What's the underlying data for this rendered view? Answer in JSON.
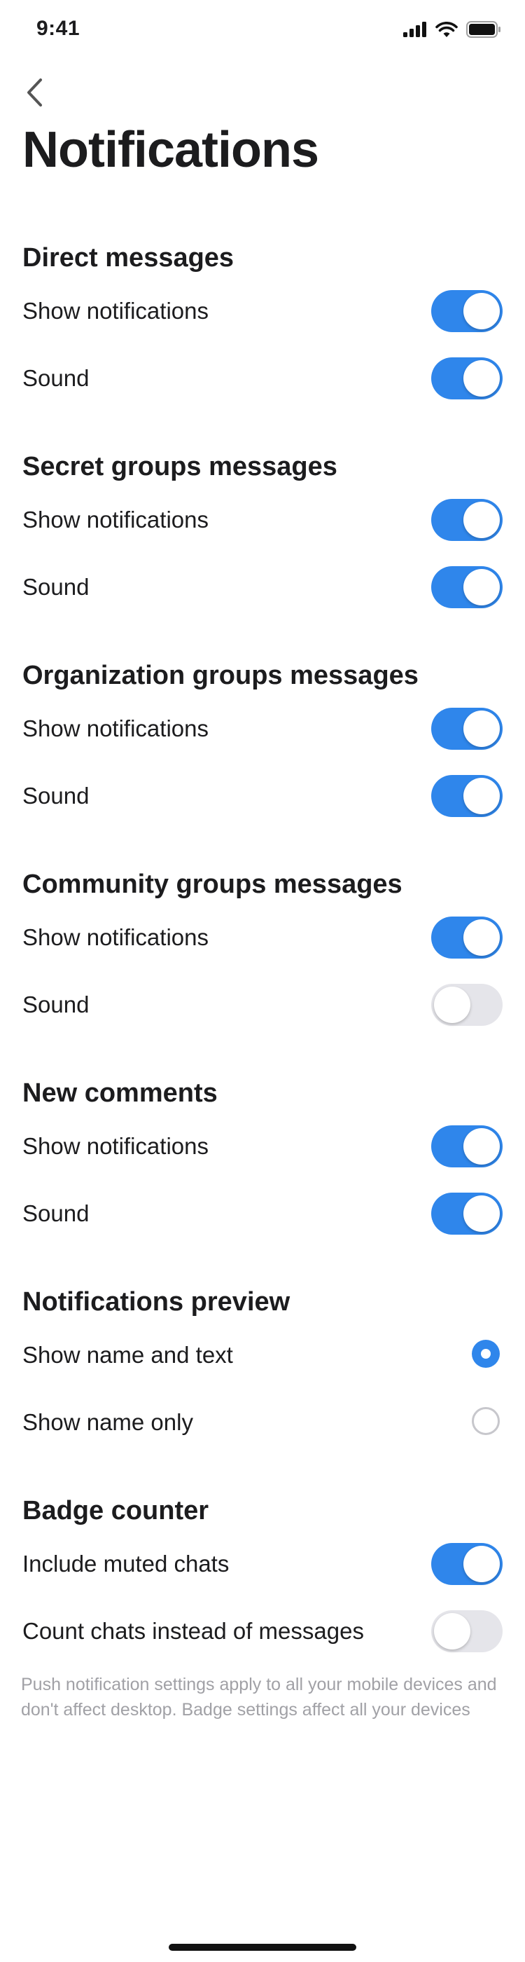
{
  "status_bar": {
    "time": "9:41"
  },
  "page": {
    "title": "Notifications"
  },
  "sections": [
    {
      "title": "Direct messages",
      "rows": [
        {
          "label": "Show notifications",
          "on": true
        },
        {
          "label": "Sound",
          "on": true
        }
      ]
    },
    {
      "title": "Secret groups messages",
      "rows": [
        {
          "label": "Show notifications",
          "on": true
        },
        {
          "label": "Sound",
          "on": true
        }
      ]
    },
    {
      "title": "Organization groups messages",
      "rows": [
        {
          "label": "Show notifications",
          "on": true
        },
        {
          "label": "Sound",
          "on": true
        }
      ]
    },
    {
      "title": "Community groups messages",
      "rows": [
        {
          "label": "Show notifications",
          "on": true
        },
        {
          "label": "Sound",
          "on": false
        }
      ]
    },
    {
      "title": "New comments",
      "rows": [
        {
          "label": "Show notifications",
          "on": true
        },
        {
          "label": "Sound",
          "on": true
        }
      ]
    },
    {
      "title": "Notifications preview",
      "rows": [
        {
          "label": "Show name and text",
          "selected": true
        },
        {
          "label": "Show name only",
          "selected": false
        }
      ]
    },
    {
      "title": "Badge counter",
      "rows": [
        {
          "label": "Include muted chats",
          "on": true
        },
        {
          "label": "Count chats instead of messages",
          "on": false
        }
      ]
    }
  ],
  "footer_note": "Push notification settings apply to all your mobile devices and don't affect desktop. Badge settings affect all your devices",
  "colors": {
    "accent": "#2f86eb",
    "toggle_off": "#e5e5ea",
    "footer_text": "#a1a1a6"
  },
  "icons": [
    "cellular-signal-icon",
    "wifi-icon",
    "battery-icon",
    "chevron-left-icon"
  ]
}
